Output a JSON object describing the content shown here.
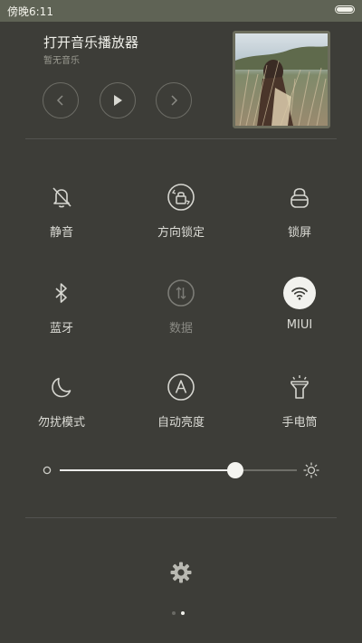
{
  "status_bar": {
    "time": "傍晚6:11"
  },
  "music": {
    "title": "打开音乐播放器",
    "subtitle": "暂无音乐",
    "controls": [
      "previous-icon",
      "play-icon",
      "next-icon"
    ]
  },
  "toggles": [
    {
      "label": "静音",
      "icon": "bell-muted-icon",
      "active": false
    },
    {
      "label": "方向锁定",
      "icon": "rotation-lock-icon",
      "active": false
    },
    {
      "label": "锁屏",
      "icon": "lock-icon",
      "active": false
    },
    {
      "label": "蓝牙",
      "icon": "bluetooth-icon",
      "active": false
    },
    {
      "label": "数据",
      "icon": "data-icon",
      "active": false,
      "disabled": true
    },
    {
      "label": "MIUI",
      "icon": "wifi-icon",
      "active": true
    },
    {
      "label": "勿扰模式",
      "icon": "moon-icon",
      "active": false
    },
    {
      "label": "自动亮度",
      "icon": "auto-brightness-icon",
      "active": false
    },
    {
      "label": "手电筒",
      "icon": "flashlight-icon",
      "active": false
    }
  ],
  "brightness": {
    "level": 0.74
  },
  "pager": {
    "count": 2,
    "current": 2
  },
  "colors": {
    "background": "#3d3d38",
    "status_bar": "#5f6355",
    "active_toggle": "#f2f2ee"
  }
}
